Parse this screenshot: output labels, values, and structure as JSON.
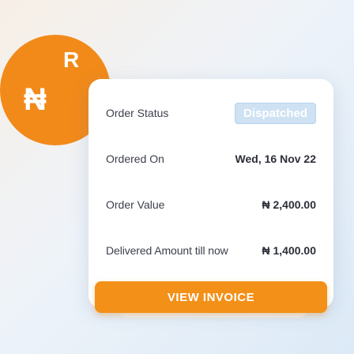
{
  "medallion": {
    "letter": "R",
    "currency_symbol": "₦",
    "color": "#f28a1a"
  },
  "order": {
    "status_label": "Order Status",
    "status_value": "Dispatched",
    "ordered_on_label": "Ordered On",
    "ordered_on_value": "Wed, 16 Nov 22",
    "order_value_label": "Order Value",
    "order_value_value": "₦ 2,400.00",
    "delivered_label": "Delivered Amount till now",
    "delivered_value": "₦ 1,400.00"
  },
  "actions": {
    "view_invoice_label": "VIEW INVOICE"
  },
  "colors": {
    "accent": "#f39018",
    "badge_background": "#cfe2f3",
    "card_background": "#ffffff"
  }
}
